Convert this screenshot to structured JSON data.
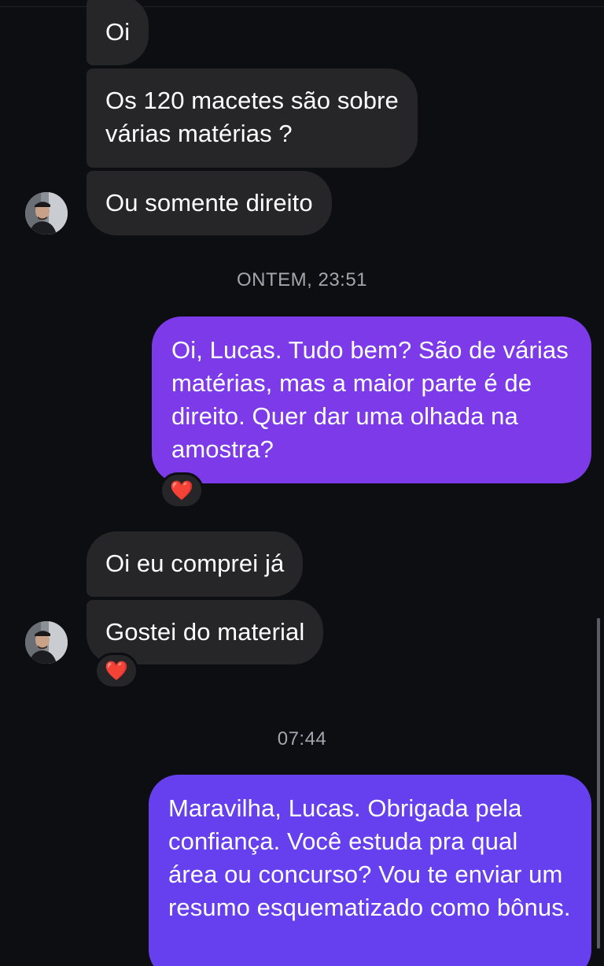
{
  "messages": [
    {
      "text": "Oi",
      "direction": "incoming"
    },
    {
      "text": "Os 120 macetes são sobre\nvárias matérias ?",
      "direction": "incoming"
    },
    {
      "text": "Ou somente direito",
      "direction": "incoming"
    },
    {
      "text": "Oi, Lucas. Tudo bem? São de várias matérias, mas a maior parte é de direito. Quer dar uma olhada na amostra?",
      "direction": "outgoing"
    },
    {
      "text": "Oi eu comprei já",
      "direction": "incoming"
    },
    {
      "text": "Gostei do material",
      "direction": "incoming"
    },
    {
      "text": "Maravilha, Lucas. Obrigada pela confiança. Você estuda pra qual área ou concurso? Vou te enviar um resumo esquematizado como bônus.",
      "direction": "outgoing"
    }
  ],
  "timestamps": [
    "ONTEM, 23:51",
    "07:44"
  ],
  "reactions": [
    "❤️",
    "❤️"
  ],
  "colors": {
    "background": "#0c0e12",
    "incoming_bubble": "#262629",
    "outgoing_bubble_1": "#7d3ae8",
    "outgoing_bubble_2": "#6640ee",
    "timestamp_text": "#a3a6ab"
  },
  "icons": {
    "avatar": "contact-avatar",
    "reaction": "heart-icon"
  }
}
